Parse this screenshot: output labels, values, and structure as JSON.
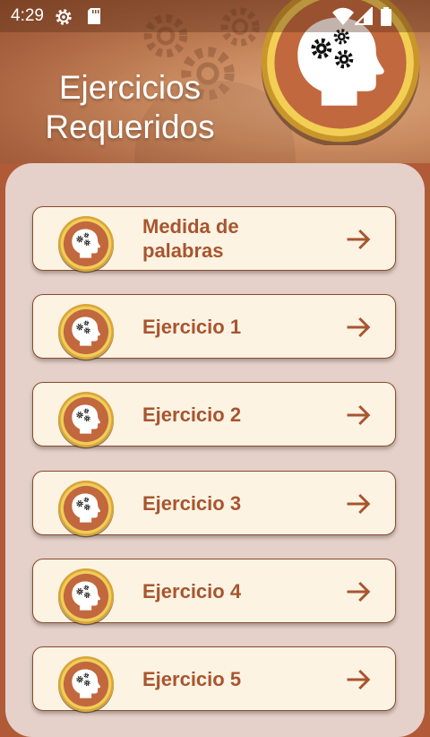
{
  "status_bar": {
    "time": "4:29",
    "icons": [
      "settings-gear-icon",
      "sd-card-icon",
      "wifi-icon",
      "cell-signal-icon",
      "battery-icon"
    ]
  },
  "header": {
    "title_line1": "Ejercicios",
    "title_line2": "Requeridos",
    "hero_icon": "head-gears-icon"
  },
  "exercises": [
    {
      "label": "Medida de palabras",
      "icon": "head-gears-icon",
      "action_icon": "arrow-right-icon"
    },
    {
      "label": "Ejercicio 1",
      "icon": "head-gears-icon",
      "action_icon": "arrow-right-icon"
    },
    {
      "label": "Ejercicio 2",
      "icon": "head-gears-icon",
      "action_icon": "arrow-right-icon"
    },
    {
      "label": "Ejercicio 3",
      "icon": "head-gears-icon",
      "action_icon": "arrow-right-icon"
    },
    {
      "label": "Ejercicio 4",
      "icon": "head-gears-icon",
      "action_icon": "arrow-right-icon"
    },
    {
      "label": "Ejercicio 5",
      "icon": "head-gears-icon",
      "action_icon": "arrow-right-icon"
    }
  ],
  "colors": {
    "accent": "#a8552f",
    "card_background": "#fdf3e3",
    "panel_background": "#e5d1c9",
    "medallion_ring": "#e0b53a",
    "medallion_fill": "#c2683e"
  }
}
